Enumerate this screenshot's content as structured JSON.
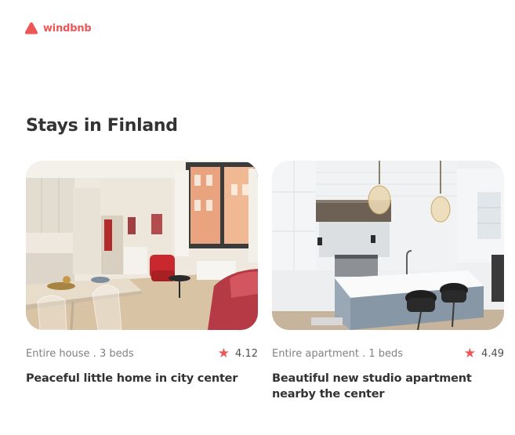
{
  "header": {
    "logo_text": "windbnb",
    "logo_icon": "house-roof-icon",
    "brand_color": "#EB5757"
  },
  "main": {
    "title": "Stays in Finland",
    "stays": [
      {
        "type": "Entire house . 3 beds",
        "rating": "4.12",
        "title": "Peaceful little home in city center",
        "photo": "bright living room with red armchair and dining table"
      },
      {
        "type": "Entire apartment . 1 beds",
        "rating": "4.49",
        "title": "Beautiful new studio apartment nearby the center",
        "photo": "white kitchen with island and bar stools"
      }
    ]
  },
  "colors": {
    "accent": "#EB5757",
    "text": "#333333",
    "muted": "#828282"
  }
}
